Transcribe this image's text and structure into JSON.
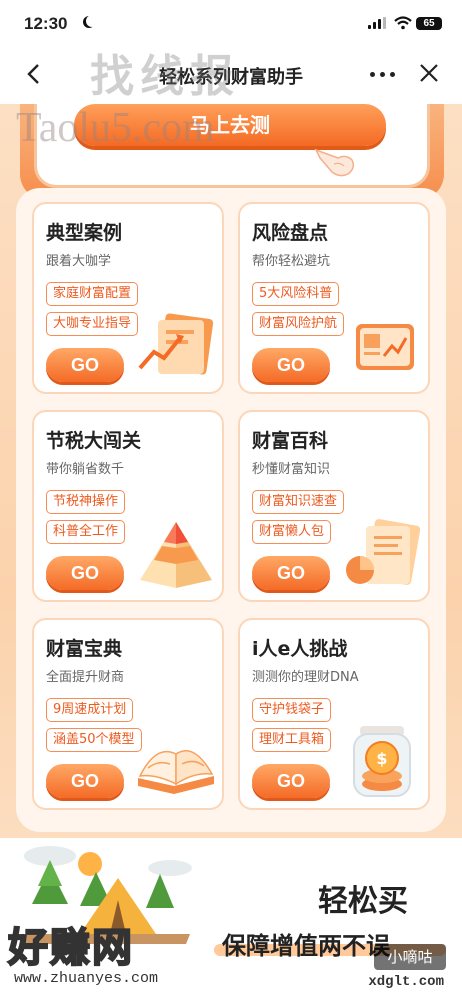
{
  "status_bar": {
    "time": "12:30",
    "battery": "65"
  },
  "nav": {
    "title": "轻松系列财富助手"
  },
  "watermarks": {
    "top": "找线报",
    "site": "Taolu5.com",
    "bottom": "好赚网",
    "bottom_url": "www.zhuanyes.com",
    "badge": "小嘀咕",
    "badge_url": "xdglt.com"
  },
  "top_banner": {
    "button_label": "马上去测"
  },
  "cards": [
    {
      "title": "典型案例",
      "subtitle": "跟着大咖学",
      "tags": [
        "家庭财富配置",
        "大咖专业指导"
      ],
      "go": "GO",
      "icon": "document-chart-icon"
    },
    {
      "title": "风险盘点",
      "subtitle": "帮你轻松避坑",
      "tags": [
        "5大风险科普",
        "财富风险护航"
      ],
      "go": "GO",
      "icon": "dashboard-chart-icon"
    },
    {
      "title": "节税大闯关",
      "subtitle": "带你躺省数千",
      "tags": [
        "节税神操作",
        "科普全工作"
      ],
      "go": "GO",
      "icon": "pyramid-icon"
    },
    {
      "title": "财富百科",
      "subtitle": "秒懂财富知识",
      "tags": [
        "财富知识速查",
        "财富懒人包"
      ],
      "go": "GO",
      "icon": "pie-chart-icon"
    },
    {
      "title": "财富宝典",
      "subtitle": "全面提升财商",
      "tags": [
        "9周速成计划",
        "涵盖50个模型"
      ],
      "go": "GO",
      "icon": "open-book-icon"
    },
    {
      "title": "i人e人挑战",
      "subtitle": "测测你的理财DNA",
      "tags": [
        "守护钱袋子",
        "理财工具箱"
      ],
      "go": "GO",
      "icon": "coin-jar-icon"
    }
  ],
  "bottom": {
    "slogan_1": "轻松买",
    "slogan_2": "保障增值两不误"
  },
  "colors": {
    "accent": "#f46b26",
    "tag_border": "#f58d55",
    "card_border": "#fbd6b8"
  }
}
